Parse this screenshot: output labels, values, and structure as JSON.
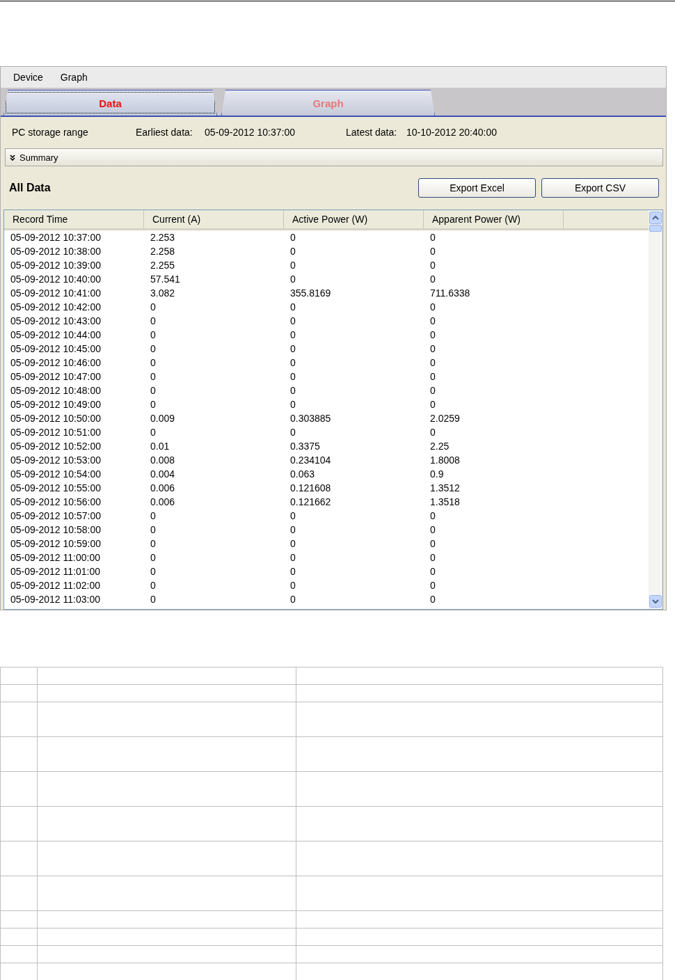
{
  "menu": [
    {
      "label": "Device"
    },
    {
      "label": "Graph"
    }
  ],
  "tabs": [
    {
      "label": "Data",
      "selected": true
    },
    {
      "label": "Graph",
      "selected": false
    }
  ],
  "storage_range": {
    "label": "PC storage range",
    "earliest_label": "Earliest data:",
    "earliest": "05-09-2012 10:37:00",
    "latest_label": "Latest data:",
    "latest": "10-10-2012 20:40:00"
  },
  "summary": {
    "label": "Summary",
    "expanded": false
  },
  "section_title": "All Data",
  "buttons": [
    {
      "label": "Export Excel"
    },
    {
      "label": "Export CSV"
    }
  ],
  "table": {
    "columns": [
      "Record Time",
      "Current (A)",
      "Active Power (W)",
      "Apparent Power (W)"
    ],
    "rows": [
      [
        "05-09-2012 10:37:00",
        "2.253",
        "0",
        "0"
      ],
      [
        "05-09-2012 10:38:00",
        "2.258",
        "0",
        "0"
      ],
      [
        "05-09-2012 10:39:00",
        "2.255",
        "0",
        "0"
      ],
      [
        "05-09-2012 10:40:00",
        "57.541",
        "0",
        "0"
      ],
      [
        "05-09-2012 10:41:00",
        "3.082",
        "355.8169",
        "711.6338"
      ],
      [
        "05-09-2012 10:42:00",
        "0",
        "0",
        "0"
      ],
      [
        "05-09-2012 10:43:00",
        "0",
        "0",
        "0"
      ],
      [
        "05-09-2012 10:44:00",
        "0",
        "0",
        "0"
      ],
      [
        "05-09-2012 10:45:00",
        "0",
        "0",
        "0"
      ],
      [
        "05-09-2012 10:46:00",
        "0",
        "0",
        "0"
      ],
      [
        "05-09-2012 10:47:00",
        "0",
        "0",
        "0"
      ],
      [
        "05-09-2012 10:48:00",
        "0",
        "0",
        "0"
      ],
      [
        "05-09-2012 10:49:00",
        "0",
        "0",
        "0"
      ],
      [
        "05-09-2012 10:50:00",
        "0.009",
        "0.303885",
        "2.0259"
      ],
      [
        "05-09-2012 10:51:00",
        "0",
        "0",
        "0"
      ],
      [
        "05-09-2012 10:52:00",
        "0.01",
        "0.3375",
        "2.25"
      ],
      [
        "05-09-2012 10:53:00",
        "0.008",
        "0.234104",
        "1.8008"
      ],
      [
        "05-09-2012 10:54:00",
        "0.004",
        "0.063",
        "0.9"
      ],
      [
        "05-09-2012 10:55:00",
        "0.006",
        "0.121608",
        "1.3512"
      ],
      [
        "05-09-2012 10:56:00",
        "0.006",
        "0.121662",
        "1.3518"
      ],
      [
        "05-09-2012 10:57:00",
        "0",
        "0",
        "0"
      ],
      [
        "05-09-2012 10:58:00",
        "0",
        "0",
        "0"
      ],
      [
        "05-09-2012 10:59:00",
        "0",
        "0",
        "0"
      ],
      [
        "05-09-2012 11:00:00",
        "0",
        "0",
        "0"
      ],
      [
        "05-09-2012 11:01:00",
        "0",
        "0",
        "0"
      ],
      [
        "05-09-2012 11:02:00",
        "0",
        "0",
        "0"
      ],
      [
        "05-09-2012 11:03:00",
        "0",
        "0",
        "0"
      ]
    ]
  }
}
